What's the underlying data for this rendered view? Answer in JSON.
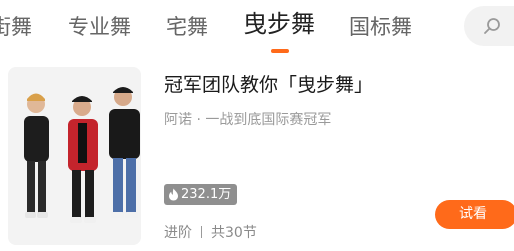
{
  "tabs": [
    {
      "label": "街舞",
      "active": false
    },
    {
      "label": "专业舞",
      "active": false
    },
    {
      "label": "宅舞",
      "active": false
    },
    {
      "label": "曳步舞",
      "active": true
    },
    {
      "label": "国标舞",
      "active": false
    }
  ],
  "search": {
    "icon": "search-icon"
  },
  "course": {
    "title": "冠军团队教你「曳步舞」",
    "subtitle": "阿诺 · 一战到底国际赛冠军",
    "views": "232.1万",
    "views_icon": "flame-icon",
    "level": "进阶",
    "lessons": "共30节",
    "trial_label": "试看"
  },
  "colors": {
    "accent": "#ff6a1a",
    "badge": "#8f8f8f"
  }
}
